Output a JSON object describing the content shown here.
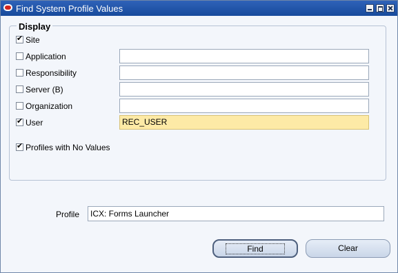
{
  "window": {
    "title": "Find System Profile Values"
  },
  "display": {
    "legend": "Display",
    "rows": [
      {
        "label": "Site",
        "checked": true,
        "value": null
      },
      {
        "label": "Application",
        "checked": false,
        "value": ""
      },
      {
        "label": "Responsibility",
        "checked": false,
        "value": ""
      },
      {
        "label": "Server (B)",
        "checked": false,
        "value": ""
      },
      {
        "label": "Organization",
        "checked": false,
        "value": ""
      },
      {
        "label": "User",
        "checked": true,
        "value": "REC_USER"
      }
    ],
    "profiles_no_values": {
      "label": "Profiles with No Values",
      "checked": true
    }
  },
  "profile": {
    "label": "Profile",
    "value": "ICX: Forms Launcher"
  },
  "buttons": {
    "find": "Find",
    "clear": "Clear"
  },
  "colors": {
    "titlebar": "#174a9c",
    "highlight_field": "#fdeaa6"
  }
}
